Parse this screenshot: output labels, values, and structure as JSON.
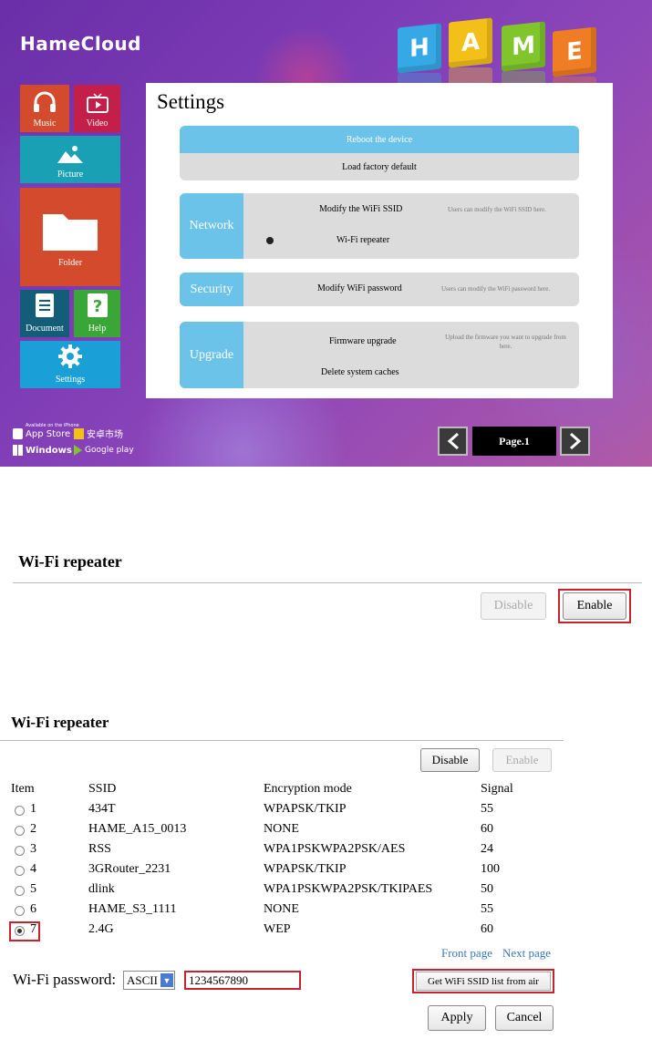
{
  "app": {
    "logo": "HameCloud",
    "cubes": [
      "H",
      "A",
      "M",
      "E"
    ],
    "colors": {
      "music": "#d44a2c",
      "video": "#c31f48",
      "picture": "#1aa0b5",
      "folder": "#d44a2c",
      "document": "#135d78",
      "help": "#3aa637",
      "settings": "#1aa0d6",
      "accent": "#6cc3ea"
    },
    "tiles": {
      "music": "Music",
      "video": "Video",
      "picture": "Picture",
      "folder": "Folder",
      "document": "Document",
      "help": "Help",
      "settings": "Settings"
    },
    "settings": {
      "title": "Settings",
      "reboot": "Reboot the device",
      "factory": "Load factory default",
      "network": {
        "tag": "Network",
        "modify_ssid": "Modify the WiFi SSID",
        "ssid_hint": "Users can modify the WiFi SSID here.",
        "repeater": "Wi-Fi repeater"
      },
      "security": {
        "tag": "Security",
        "modify_password": "Modify WiFi password",
        "password_hint": "Users can modify the WiFi password here."
      },
      "upgrade": {
        "tag": "Upgrade",
        "firmware": "Firmware upgrade",
        "firmware_hint": "Upload the firmware you want to upgrade from here.",
        "caches": "Delete system caches"
      }
    },
    "stores": {
      "appstore_small": "Available on the iPhone",
      "appstore": "App Store",
      "android_market": "安卓市场",
      "windows": "Windows",
      "google_play": "Google play"
    },
    "pager": {
      "label": "Page.1"
    }
  },
  "enable_screen": {
    "title": "Wi-Fi repeater",
    "disable_label": "Disable",
    "enable_label": "Enable"
  },
  "list_screen": {
    "title": "Wi-Fi repeater",
    "disable_label": "Disable",
    "enable_label": "Enable",
    "columns": [
      "Item",
      "SSID",
      "Encryption mode",
      "Signal"
    ],
    "rows": [
      {
        "item": "1",
        "ssid": "434T",
        "encryption": "WPAPSK/TKIP",
        "signal": "55"
      },
      {
        "item": "2",
        "ssid": "HAME_A15_0013",
        "encryption": "NONE",
        "signal": "60"
      },
      {
        "item": "3",
        "ssid": "RSS",
        "encryption": "WPA1PSKWPA2PSK/AES",
        "signal": "24"
      },
      {
        "item": "4",
        "ssid": "3GRouter_2231",
        "encryption": "WPAPSK/TKIP",
        "signal": "100"
      },
      {
        "item": "5",
        "ssid": "dlink",
        "encryption": "WPA1PSKWPA2PSK/TKIPAES",
        "signal": "50"
      },
      {
        "item": "6",
        "ssid": "HAME_S3_1111",
        "encryption": "NONE",
        "signal": "55"
      },
      {
        "item": "7",
        "ssid": "2.4G",
        "encryption": "WEP",
        "signal": "60"
      }
    ],
    "selected_item": "7",
    "front_page": "Front page",
    "next_page": "Next page",
    "password_label": "Wi-Fi password:",
    "password_mode": "ASCII",
    "password_value": "1234567890",
    "get_ssid_label": "Get WiFi SSID list from air",
    "apply_label": "Apply",
    "cancel_label": "Cancel",
    "highlight_color": "#c8232c",
    "link_color": "#3a78b8"
  }
}
